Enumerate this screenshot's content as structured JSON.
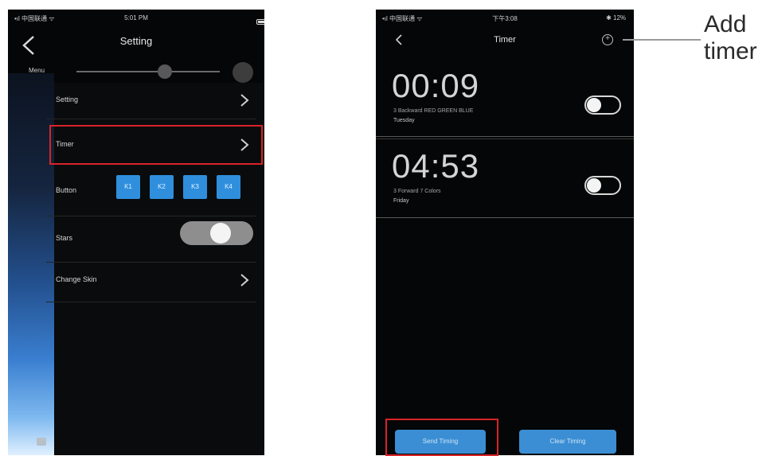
{
  "left_screen": {
    "status": {
      "left": "•ıl 中国联通 ᯤ",
      "center": "5:01 PM"
    },
    "title": "Setting",
    "menu_label": "Menu",
    "rows": {
      "setting": "Setting",
      "timer": "Timer",
      "button": "Button",
      "stars": "Stars",
      "skin": "Change Skin"
    },
    "buttons": [
      "K1",
      "K2",
      "K3",
      "K4"
    ],
    "stars_toggle_on": true
  },
  "right_screen": {
    "status": {
      "left": "•ıl 中国联通 ᯤ",
      "center": "下午3:08",
      "right": "✱ 12%"
    },
    "title": "Timer",
    "timers": [
      {
        "time": "00:09",
        "desc": "3 Backward RED GREEN BLUE",
        "day": "Tuesday",
        "enabled": false
      },
      {
        "time": "04:53",
        "desc": "3 Forward 7 Colors",
        "day": "Friday",
        "enabled": false
      }
    ],
    "send_button": "Send Timing",
    "clear_button": "Clear Timing"
  },
  "annotation": {
    "line1": "Add",
    "line2": "timer"
  },
  "colors": {
    "highlight": "#d8232a",
    "button_blue": "#2f8fdd",
    "background": "#050607"
  }
}
